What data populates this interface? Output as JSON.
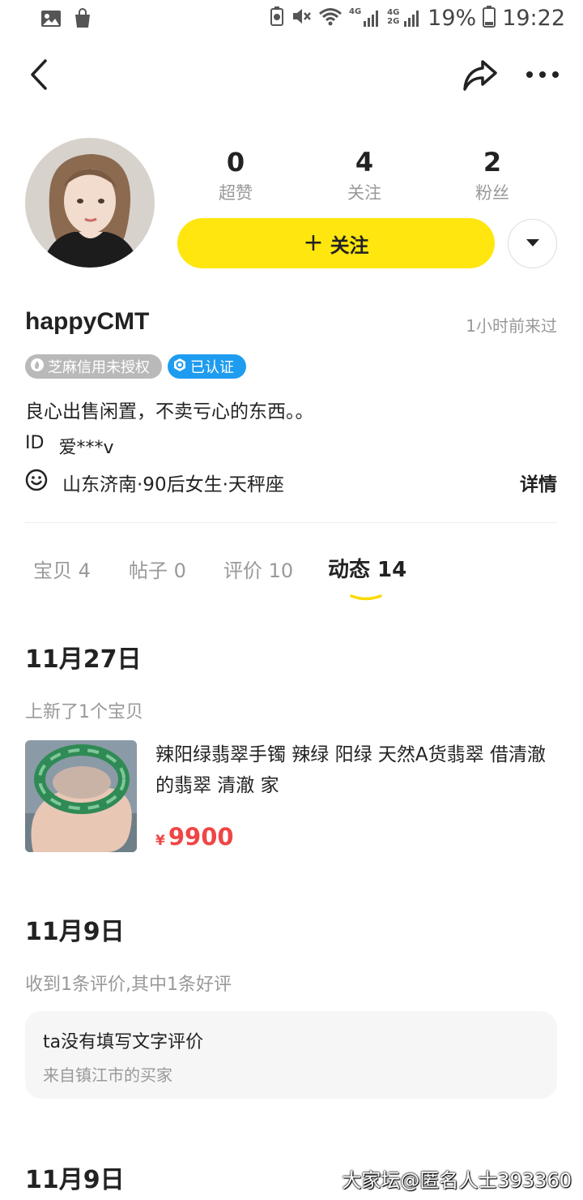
{
  "status_bar": {
    "network_4g_1": "4G",
    "network_4g_2": "4G 2G",
    "battery": "19%",
    "time": "19:22"
  },
  "profile": {
    "stats": [
      {
        "value": "0",
        "label": "超赞"
      },
      {
        "value": "4",
        "label": "关注"
      },
      {
        "value": "2",
        "label": "粉丝"
      }
    ],
    "follow_button": {
      "plus": "+",
      "label": "关注"
    },
    "username": "happyCMT",
    "last_seen": "1小时前来过",
    "badges": {
      "credit": "芝麻信用未授权",
      "verified": "已认证"
    },
    "bio": "良心出售闲置，不卖亏心的东西。。",
    "id_label": "ID",
    "id_value": "爱***v",
    "location": "山东济南·90后女生·天秤座",
    "details": "详情"
  },
  "tabs": [
    {
      "label": "宝贝 4"
    },
    {
      "label": "帖子 0"
    },
    {
      "label": "评价 10"
    },
    {
      "label": "动态 14"
    }
  ],
  "feed": [
    {
      "date": "11月27日",
      "summary": "上新了1个宝贝",
      "product": {
        "title": "辣阳绿翡翠手镯 辣绿 阳绿 天然A货翡翠 借清澈的翡翠 清澈 家",
        "currency": "¥",
        "price": "9900"
      }
    },
    {
      "date": "11月9日",
      "summary": "收到1条评价,其中1条好评",
      "review": {
        "text": "ta没有填写文字评价",
        "from": "来自镇江市的买家"
      }
    },
    {
      "date": "11月9日"
    }
  ],
  "watermark": "大家坛@匿名人士393360",
  "colors": {
    "accent_yellow": "#ffe60f",
    "verified_blue": "#1e9cf0",
    "price_red": "#f04545",
    "muted_gray": "#999999"
  },
  "icons": [
    "gallery-icon",
    "shopping-bag-icon",
    "battery-saver-icon",
    "mute-icon",
    "wifi-icon",
    "signal-icon",
    "battery-icon",
    "back-icon",
    "share-icon",
    "more-icon",
    "chevron-down-icon",
    "flame-icon",
    "shield-icon",
    "smiley-icon"
  ],
  "active_tab": "动态 14"
}
